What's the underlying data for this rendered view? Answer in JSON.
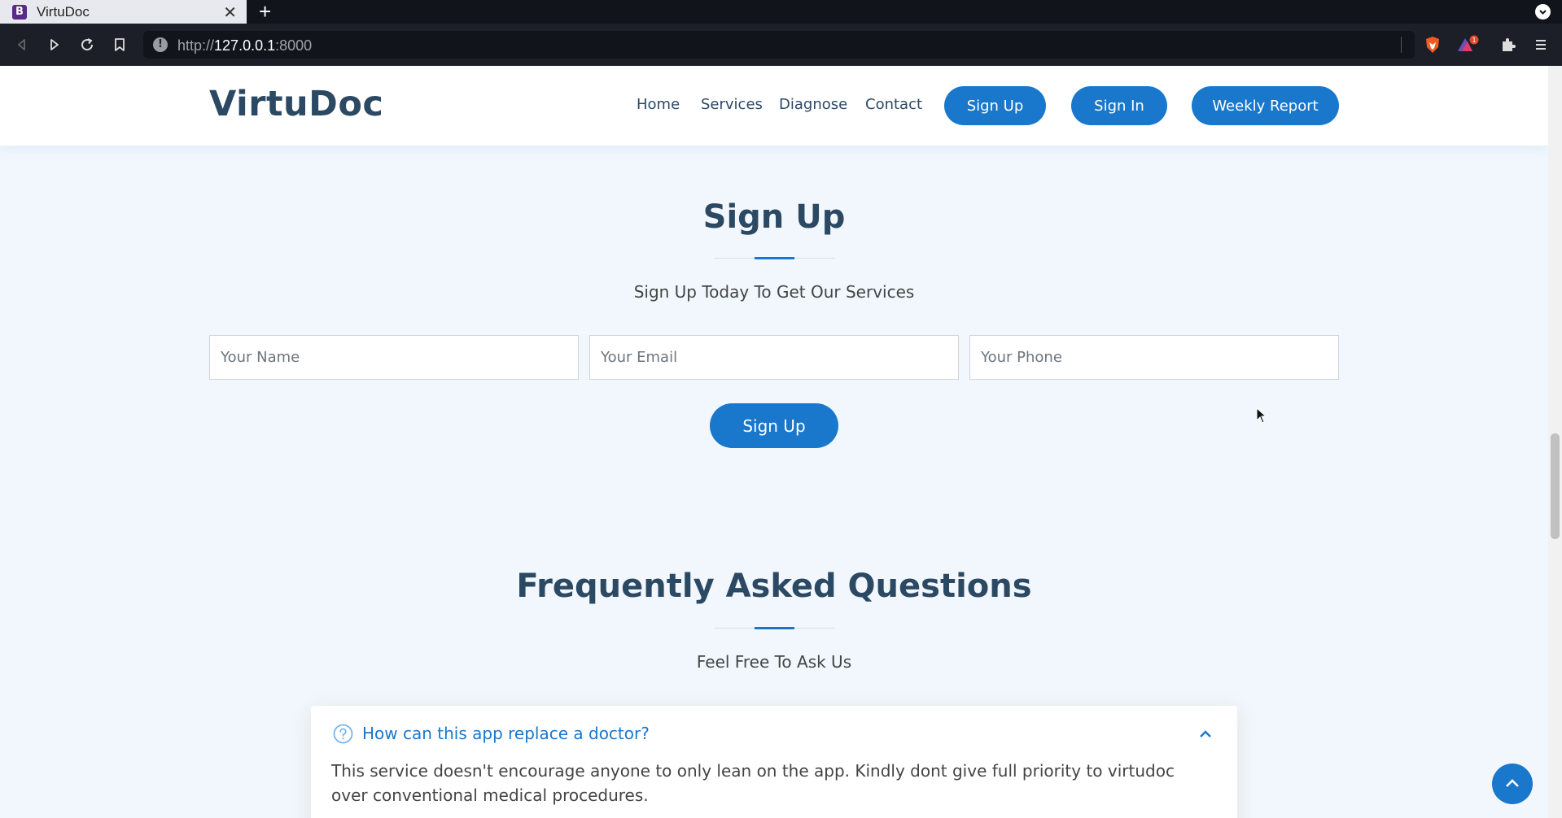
{
  "browser": {
    "tab_title": "VirtuDoc",
    "tab_favicon_letter": "B",
    "url_prefix": "http://",
    "url_host": "127.0.0.1",
    "url_port": ":8000",
    "shield_notification_count": "1"
  },
  "header": {
    "logo": "VirtuDoc",
    "nav": {
      "home": "Home",
      "services": "Services",
      "diagnose": "Diagnose",
      "contact": "Contact"
    },
    "buttons": {
      "sign_up": "Sign Up",
      "sign_in": "Sign In",
      "weekly_report": "Weekly Report"
    }
  },
  "signup": {
    "title": "Sign Up",
    "subtitle": "Sign Up Today To Get Our Services",
    "name_placeholder": "Your Name",
    "email_placeholder": "Your Email",
    "phone_placeholder": "Your Phone",
    "submit_label": "Sign Up"
  },
  "faq": {
    "title": "Frequently Asked Questions",
    "subtitle": "Feel Free To Ask Us",
    "items": [
      {
        "question": "How can this app replace a doctor?",
        "answer": "This service doesn't encourage anyone to only lean on the app. Kindly dont give full priority to virtudoc over conventional medical procedures.",
        "expanded": true
      }
    ]
  },
  "colors": {
    "accent": "#1977cc",
    "heading": "#2c4964",
    "page_bg": "#f1f7fc"
  }
}
